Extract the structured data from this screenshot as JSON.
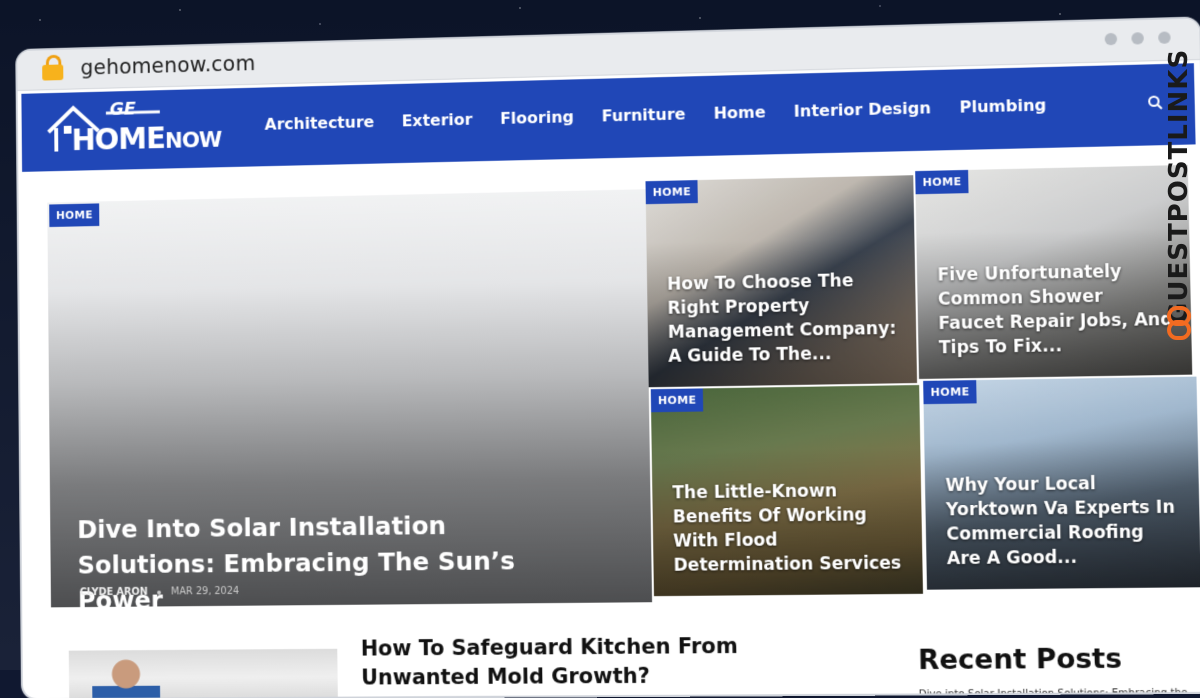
{
  "browser": {
    "url": "gehomenow.com"
  },
  "site": {
    "logo_text_top": "GE",
    "logo_text_main": "HOME",
    "logo_text_small": "NOW"
  },
  "nav": {
    "items": [
      "Architecture",
      "Exterior",
      "Flooring",
      "Furniture",
      "Home",
      "Interior Design",
      "Plumbing"
    ]
  },
  "hero": {
    "tag": "HOME",
    "title": "Dive Into Solar Installation Solutions: Embracing The Sun’s Power",
    "author": "CLYDE ARON",
    "date": "MAR 29, 2024"
  },
  "cards": [
    {
      "tag": "HOME",
      "title": "How To Choose The Right Property Management Company: A Guide To The..."
    },
    {
      "tag": "HOME",
      "title": "Five Unfortunately Common Shower Faucet Repair Jobs, And Tips To Fix..."
    },
    {
      "tag": "HOME",
      "title": "The Little-Known Benefits Of Working With Flood Determination Services"
    },
    {
      "tag": "HOME",
      "title": "Why Your Local Yorktown Va Experts In Commercial Roofing Are A Good..."
    }
  ],
  "latest": {
    "title": "How To Safeguard Kitchen From Unwanted Mold Growth?"
  },
  "sidebar": {
    "recent_title": "Recent Posts",
    "recent_first": "Dive into Solar Installation Solutions: Embracing the"
  },
  "watermark": {
    "text": "GUESTPOSTLINKS"
  },
  "colors": {
    "brand_blue": "#2047b7",
    "lock": "#f7b21c"
  }
}
